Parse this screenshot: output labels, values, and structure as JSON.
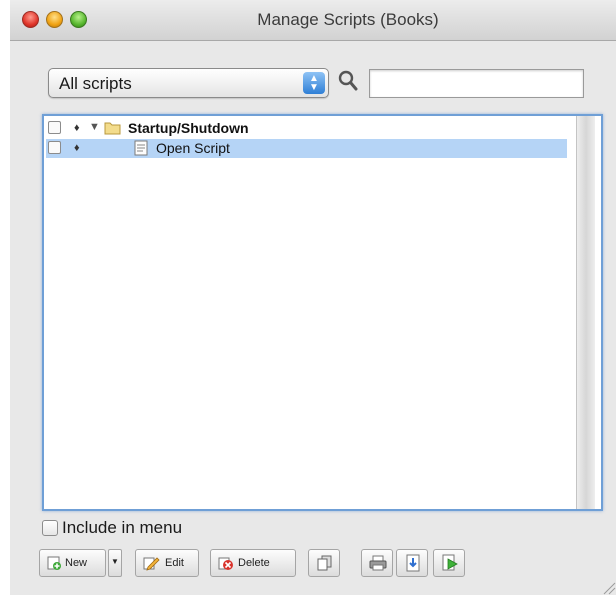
{
  "window": {
    "title": "Manage Scripts (Books)"
  },
  "filter": {
    "selected": "All scripts",
    "search_placeholder": ""
  },
  "scripts": [
    {
      "label": "Startup/Shutdown",
      "type": "folder",
      "expanded": true
    },
    {
      "label": "Open Script",
      "type": "script",
      "selected": true
    }
  ],
  "include_in_menu": {
    "label": "Include in menu",
    "checked": false
  },
  "toolbar": {
    "new_label": "New",
    "edit_label": "Edit",
    "delete_label": "Delete"
  },
  "colors": {
    "selection": "#b5d4f6",
    "focus_ring": "#6f9fd6"
  },
  "icons": [
    "search-icon",
    "folder-icon",
    "script-icon",
    "print-icon",
    "import-icon",
    "run-icon",
    "duplicate-icon"
  ]
}
